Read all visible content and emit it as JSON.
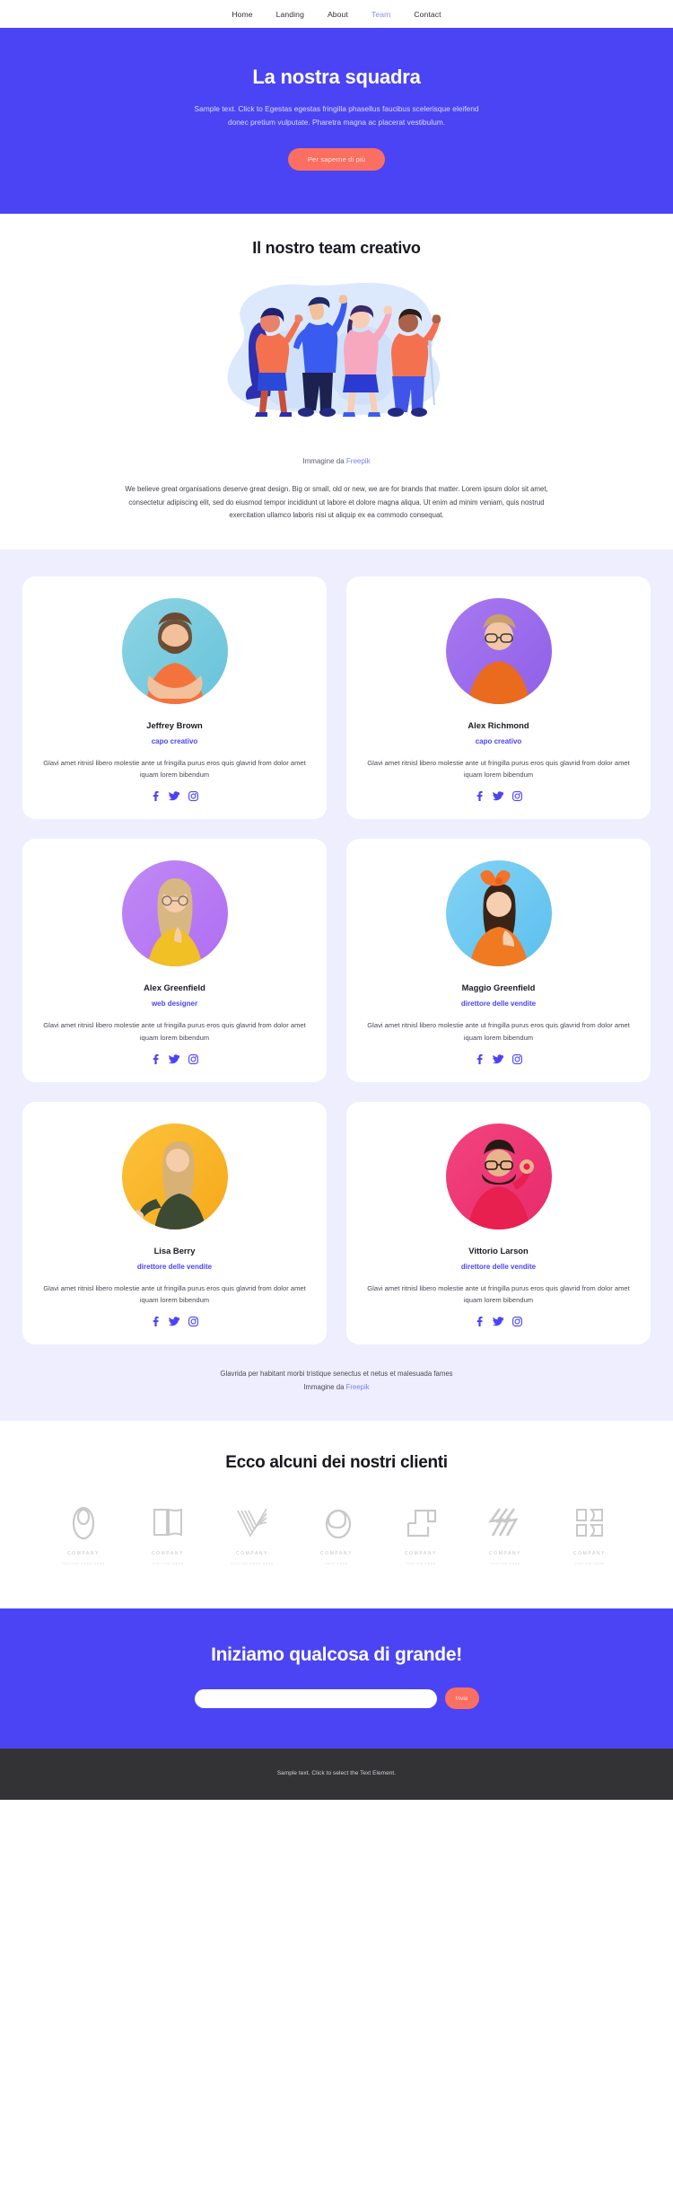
{
  "nav": {
    "items": [
      {
        "label": "Home",
        "active": false
      },
      {
        "label": "Landing",
        "active": false
      },
      {
        "label": "About",
        "active": false
      },
      {
        "label": "Team",
        "active": true
      },
      {
        "label": "Contact",
        "active": false
      }
    ]
  },
  "hero": {
    "title": "La nostra squadra",
    "subtitle": "Sample text. Click to Egestas egestas fringilla phasellus faucibus scelerisque eleifend donec pretium vulputate. Pharetra magna ac placerat vestibulum.",
    "cta_label": "Per saperne di più",
    "bg_color": "#4b44f5",
    "cta_color": "#fa6f61"
  },
  "creative": {
    "title": "Il nostro team creativo",
    "credit_prefix": "Immagine da ",
    "credit_link": "Freepik",
    "body": "We believe great organisations deserve great design. Big or small, old or new, we are for brands that matter. Lorem ipsum dolor sit amet, consectetur adipiscing elit, sed do eiusmod tempor incididunt ut labore et dolore magna aliqua. Ut enim ad minim veniam, quis nostrud exercitation ullamco laboris nisi ut aliquip ex ea commodo consequat."
  },
  "team": {
    "bio": "Glavi amet ritnisl libero molestie ante ut fringilla purus eros quis glavrid from dolor amet iquam lorem bibendum",
    "social_icons": [
      "facebook-icon",
      "twitter-icon",
      "instagram-icon"
    ],
    "accent_color": "#4b44f5",
    "members": [
      {
        "name": "Jeffrey Brown",
        "role": "capo creativo",
        "avatar_bg": "#67c3da",
        "avatar_bg2": "#8ed4e4",
        "shirt": "#f4733c",
        "skin": "#f2c09a",
        "hair": "#6b4a32",
        "kind": "male-beard"
      },
      {
        "name": "Alex Richmond",
        "role": "capo creativo",
        "avatar_bg": "#8f5fe8",
        "avatar_bg2": "#a879f0",
        "shirt": "#ea6a1e",
        "skin": "#f3c6a4",
        "hair": "#caa06a",
        "kind": "male-glasses"
      },
      {
        "name": "Alex Greenfield",
        "role": "web designer",
        "avatar_bg": "#b06ef2",
        "avatar_bg2": "#c089f5",
        "shirt": "#f0c024",
        "skin": "#f5cda9",
        "hair": "#d9b783",
        "kind": "female-glasses"
      },
      {
        "name": "Maggio Greenfield",
        "role": "direttore delle vendite",
        "avatar_bg": "#5cc0ee",
        "avatar_bg2": "#84d2f4",
        "shirt": "#f07a22",
        "skin": "#f6ceb0",
        "hair": "#3a2418",
        "kind": "female-bow"
      },
      {
        "name": "Lisa Berry",
        "role": "direttore delle vendite",
        "avatar_bg": "#f7a91a",
        "avatar_bg2": "#fbc23b",
        "shirt": "#3c4a33",
        "skin": "#f5cda9",
        "hair": "#d8b175",
        "kind": "female-blonde"
      },
      {
        "name": "Vittorio Larson",
        "role": "direttore delle vendite",
        "avatar_bg": "#e8296b",
        "avatar_bg2": "#f2457f",
        "shirt": "#e8204f",
        "skin": "#e8b48c",
        "hair": "#241a14",
        "kind": "male-ok"
      }
    ],
    "footer_line": "Glavrida per habitant morbi tristique senectus et netus et malesuada fames",
    "footer_credit_prefix": "Immagine da ",
    "footer_credit_link": "Freepik"
  },
  "clients": {
    "title": "Ecco alcuni dei nostri clienti",
    "logos": [
      {
        "name": "COMPANY",
        "tagline": "TAGLINE GOES HERE",
        "icon": "oval-loop-logo"
      },
      {
        "name": "COMPANY",
        "tagline": "TAG LINE HERE",
        "icon": "open-book-logo"
      },
      {
        "name": "COMPANY",
        "tagline": "TAGLINE GOES HERE",
        "icon": "striped-v-logo"
      },
      {
        "name": "COMPANY",
        "tagline": "TEXT HERE",
        "icon": "circle-leaf-logo"
      },
      {
        "name": "COMPANY",
        "tagline": "TAGLINE HERE",
        "icon": "bracket-square-logo"
      },
      {
        "name": "COMPANY",
        "tagline": "TAGLINE HERE",
        "icon": "slash-lines-logo"
      },
      {
        "name": "COMPANY",
        "tagline": "TAGLINE HERE",
        "icon": "mirrored-bracket-logo"
      }
    ]
  },
  "cta": {
    "title": "Iniziamo qualcosa di grande!",
    "input_value": "",
    "input_placeholder": "",
    "button_label": "Invia"
  },
  "footer": {
    "text": "Sample text. Click to select the Text Element."
  }
}
